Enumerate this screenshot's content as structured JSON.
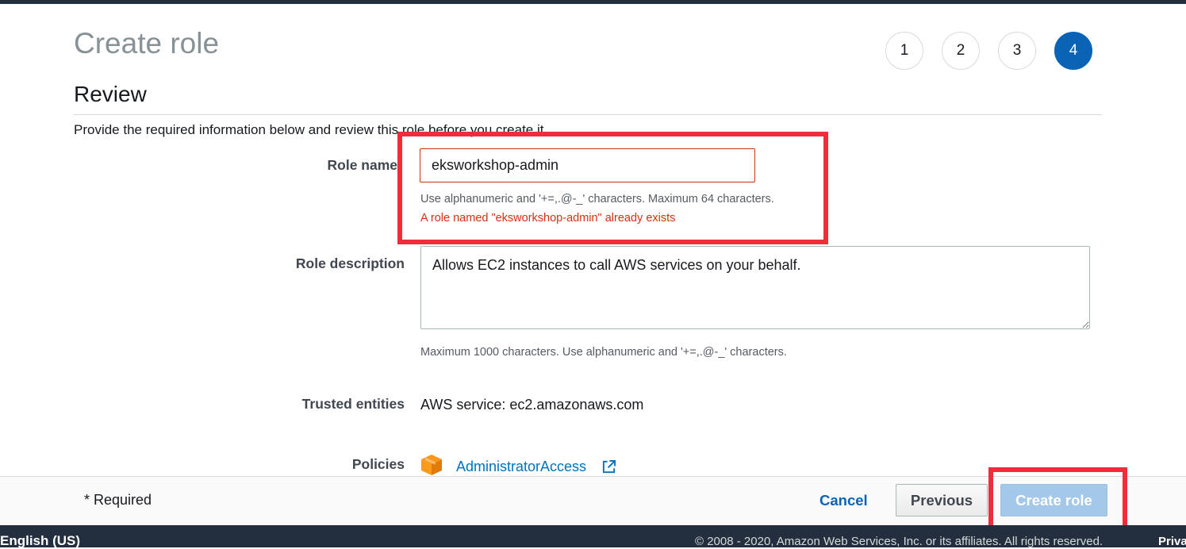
{
  "page": {
    "title": "Create role",
    "steps": [
      "1",
      "2",
      "3",
      "4"
    ],
    "active_step": "4"
  },
  "review": {
    "title": "Review",
    "intro": "Provide the required information below and review this role before you create it."
  },
  "role_name": {
    "label": "Role name",
    "value": "eksworkshop-admin",
    "help": "Use alphanumeric and '+=,.@-_' characters. Maximum 64 characters.",
    "error": "A role named \"eksworkshop-admin\" already exists"
  },
  "role_description": {
    "label": "Role description",
    "value": "Allows EC2 instances to call AWS services on your behalf.",
    "help": "Maximum 1000 characters. Use alphanumeric and '+=,.@-_' characters."
  },
  "trusted_entities": {
    "label": "Trusted entities",
    "value": "AWS service: ec2.amazonaws.com"
  },
  "policies": {
    "label": "Policies",
    "items": [
      "AdministratorAccess"
    ]
  },
  "footer": {
    "required_note": "* Required",
    "cancel_label": "Cancel",
    "previous_label": "Previous",
    "create_label": "Create role"
  },
  "bottom": {
    "language": "English (US)",
    "copyright": "© 2008 - 2020, Amazon Web Services, Inc. or its affiliates. All rights reserved.",
    "privacy": "Privacy Policy"
  },
  "colors": {
    "active_step": "#0b63b6",
    "error": "#d13212",
    "link": "#0073bb",
    "highlight_box": "#ee2e3a",
    "create_button_disabled": "#a4c8ea",
    "footer_dark": "#232f3e",
    "policy_icon": "#f7981d"
  },
  "icons": {
    "policy": "aws-policy-cube-icon",
    "external": "external-link-icon"
  }
}
